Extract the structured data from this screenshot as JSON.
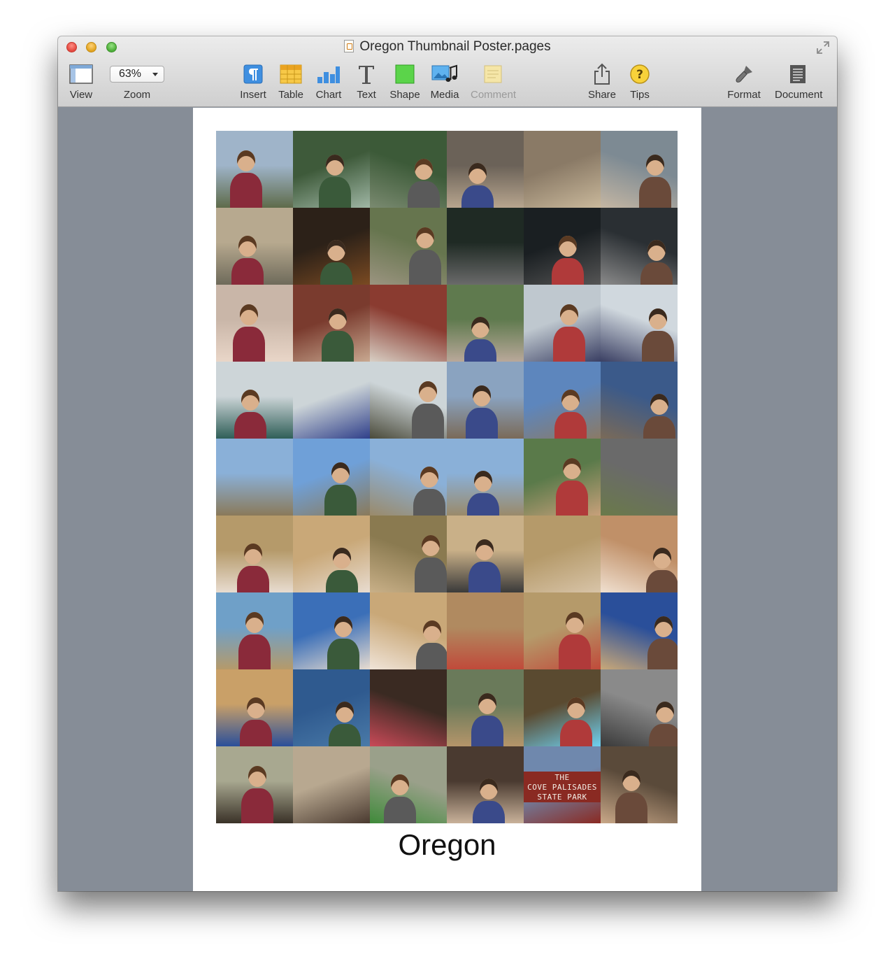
{
  "window": {
    "title": "Oregon Thumbnail Poster.pages"
  },
  "toolbar": {
    "zoom_value": "63%",
    "view_label": "View",
    "zoom_label": "Zoom",
    "insert_label": "Insert",
    "table_label": "Table",
    "chart_label": "Chart",
    "text_label": "Text",
    "shape_label": "Shape",
    "media_label": "Media",
    "comment_label": "Comment",
    "share_label": "Share",
    "tips_label": "Tips",
    "format_label": "Format",
    "document_label": "Document"
  },
  "document": {
    "caption": "Oregon",
    "sign_text": "THE\nCOVE PALISADES\nSTATE PARK",
    "photo_count": 54
  }
}
